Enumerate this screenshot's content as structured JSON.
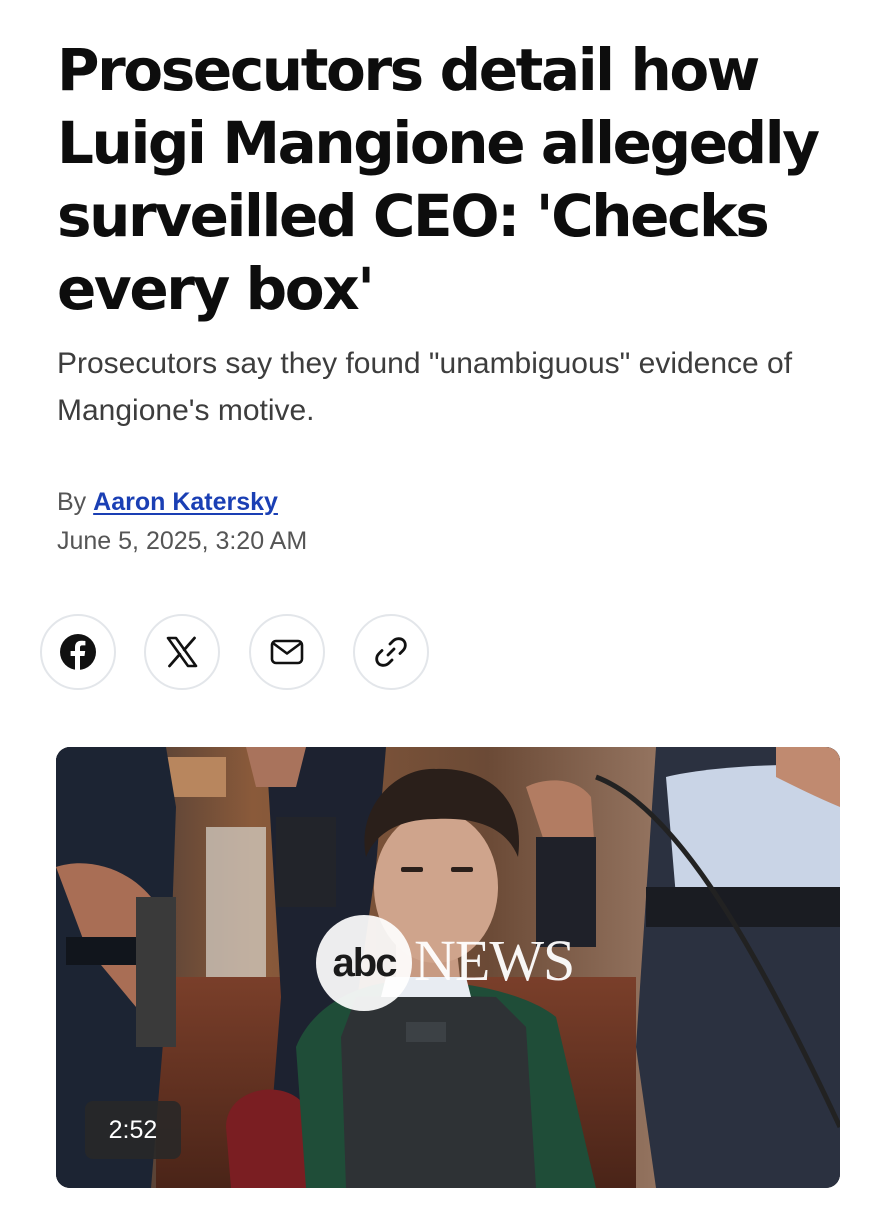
{
  "article": {
    "headline": "Prosecutors detail how Luigi Mangione allegedly surveilled CEO: 'Checks every box'",
    "dek": "Prosecutors say they found \"unambiguous\" evidence of Mangione's motive.",
    "byline_prefix": "By",
    "author": "Aaron Katersky",
    "date": "June 5, 2025, 3:20 AM"
  },
  "share": {
    "buttons": [
      {
        "name": "facebook",
        "icon": "facebook-icon"
      },
      {
        "name": "x",
        "icon": "x-icon"
      },
      {
        "name": "email",
        "icon": "mail-icon"
      },
      {
        "name": "copy-link",
        "icon": "link-icon"
      }
    ]
  },
  "video": {
    "duration": "2:52",
    "watermark_logo": "abc",
    "watermark_text": "NEWS"
  },
  "colors": {
    "author_link": "#1a3fb4",
    "headline": "#0d0d0d",
    "dek": "#3d3d3d",
    "meta": "#555555",
    "share_border": "#e3e6ea"
  }
}
